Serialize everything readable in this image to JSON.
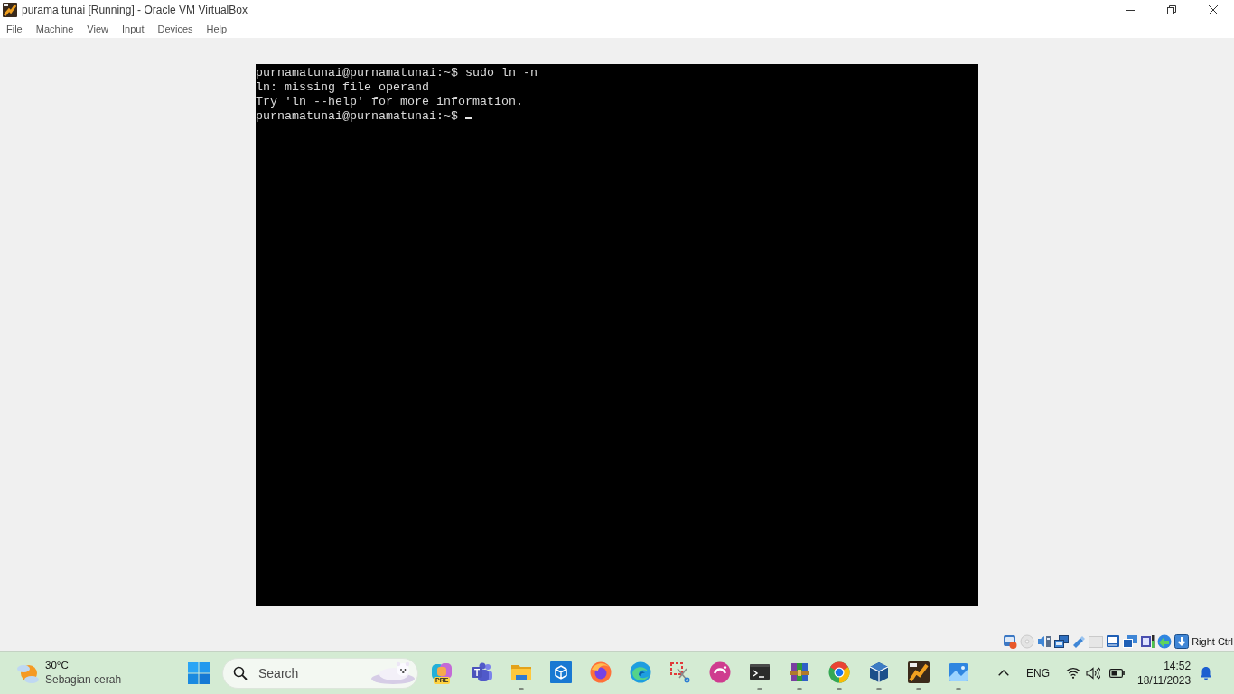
{
  "window": {
    "title": "purama tunai [Running] - Oracle VM VirtualBox"
  },
  "menu_bar": {
    "items": [
      "File",
      "Machine",
      "View",
      "Input",
      "Devices",
      "Help"
    ]
  },
  "vm_screen": {
    "lines": [
      "purnamatunai@purnamatunai:~$ sudo ln -n",
      "ln: missing file operand",
      "Try 'ln --help' for more information.",
      "purnamatunai@purnamatunai:~$"
    ],
    "cursor": true
  },
  "status_bar": {
    "host_key": "Right Ctrl"
  },
  "taskbar": {
    "weather": {
      "temperature": "30°C",
      "condition": "Sebagian cerah"
    },
    "search": {
      "placeholder": "Search"
    },
    "apps": [
      {
        "kind": "petal",
        "badge": "PRE",
        "running": false
      },
      {
        "kind": "people",
        "badge": "T",
        "running": false
      },
      {
        "kind": "folder",
        "running": true
      },
      {
        "kind": "cube",
        "running": false
      },
      {
        "kind": "globe",
        "running": false
      },
      {
        "kind": "wave",
        "running": false
      },
      {
        "kind": "scissors",
        "running": false
      },
      {
        "kind": "disc",
        "running": false
      },
      {
        "kind": "terminal",
        "running": true
      },
      {
        "kind": "books",
        "running": true
      },
      {
        "kind": "ring",
        "running": true
      },
      {
        "kind": "box",
        "running": true
      },
      {
        "kind": "bolt",
        "running": true
      },
      {
        "kind": "picture",
        "running": true
      }
    ],
    "tray": {
      "language": "ENG",
      "time": "14:52",
      "date": "18/11/2023"
    }
  }
}
